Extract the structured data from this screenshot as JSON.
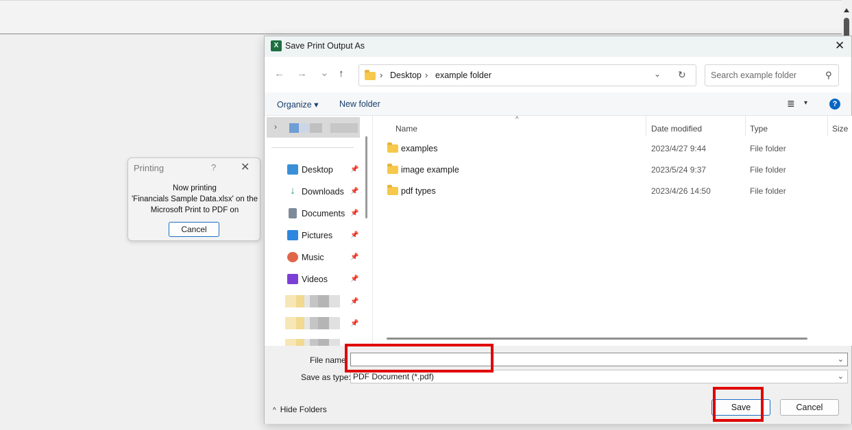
{
  "printing_dialog": {
    "title": "Printing",
    "help_glyph": "?",
    "close_glyph": "✕",
    "message_line1": "Now printing",
    "message_line2": "'Financials Sample Data.xlsx' on the",
    "message_line3": "Microsoft Print to PDF on",
    "cancel_label": "Cancel"
  },
  "save_dialog": {
    "title": "Save Print Output As",
    "app_icon_letter": "X",
    "close_glyph": "✕",
    "nav": {
      "back_glyph": "←",
      "forward_glyph": "→",
      "recent_glyph": "⌄",
      "up_glyph": "↑"
    },
    "address": {
      "crumbs": [
        "Desktop",
        "example folder"
      ],
      "separator": "›",
      "dropdown_glyph": "⌄",
      "refresh_glyph": "↻"
    },
    "search": {
      "placeholder": "Search example folder",
      "icon_glyph": "⚲"
    },
    "command_bar": {
      "organize_label": "Organize ▾",
      "new_folder_label": "New folder",
      "view_glyph": "≣",
      "view_dropdown_glyph": "▾",
      "help_glyph": "?"
    },
    "nav_pane": {
      "expand_glyph": "›",
      "pin_glyph": "📌",
      "items": [
        {
          "label": "Desktop",
          "color": "#3a8fd6"
        },
        {
          "label": "Downloads",
          "color": "#1c9a5b"
        },
        {
          "label": "Documents",
          "color": "#7d8a99"
        },
        {
          "label": "Pictures",
          "color": "#2e86de"
        },
        {
          "label": "Music",
          "color": "#e0664a"
        },
        {
          "label": "Videos",
          "color": "#7c3fd6"
        }
      ]
    },
    "file_list": {
      "columns": {
        "name": "Name",
        "date": "Date modified",
        "type": "Type",
        "size": "Size"
      },
      "sort_glyph": "^",
      "rows": [
        {
          "name": "examples",
          "date": "2023/4/27 9:44",
          "type": "File folder"
        },
        {
          "name": "image example",
          "date": "2023/5/24 9:37",
          "type": "File folder"
        },
        {
          "name": "pdf types",
          "date": "2023/4/26 14:50",
          "type": "File folder"
        }
      ]
    },
    "bottom": {
      "file_name_label": "File name:",
      "file_name_value": "",
      "save_type_label": "Save as type:",
      "save_type_value": "PDF Document (*.pdf)",
      "dropdown_glyph": "⌄",
      "hide_folders_label": "Hide Folders",
      "hide_folders_glyph": "^",
      "save_label": "Save",
      "cancel_label": "Cancel"
    }
  },
  "colors": {
    "highlight": "#e00000",
    "accent": "#1a6fc4",
    "folder": "#f6c94c"
  }
}
